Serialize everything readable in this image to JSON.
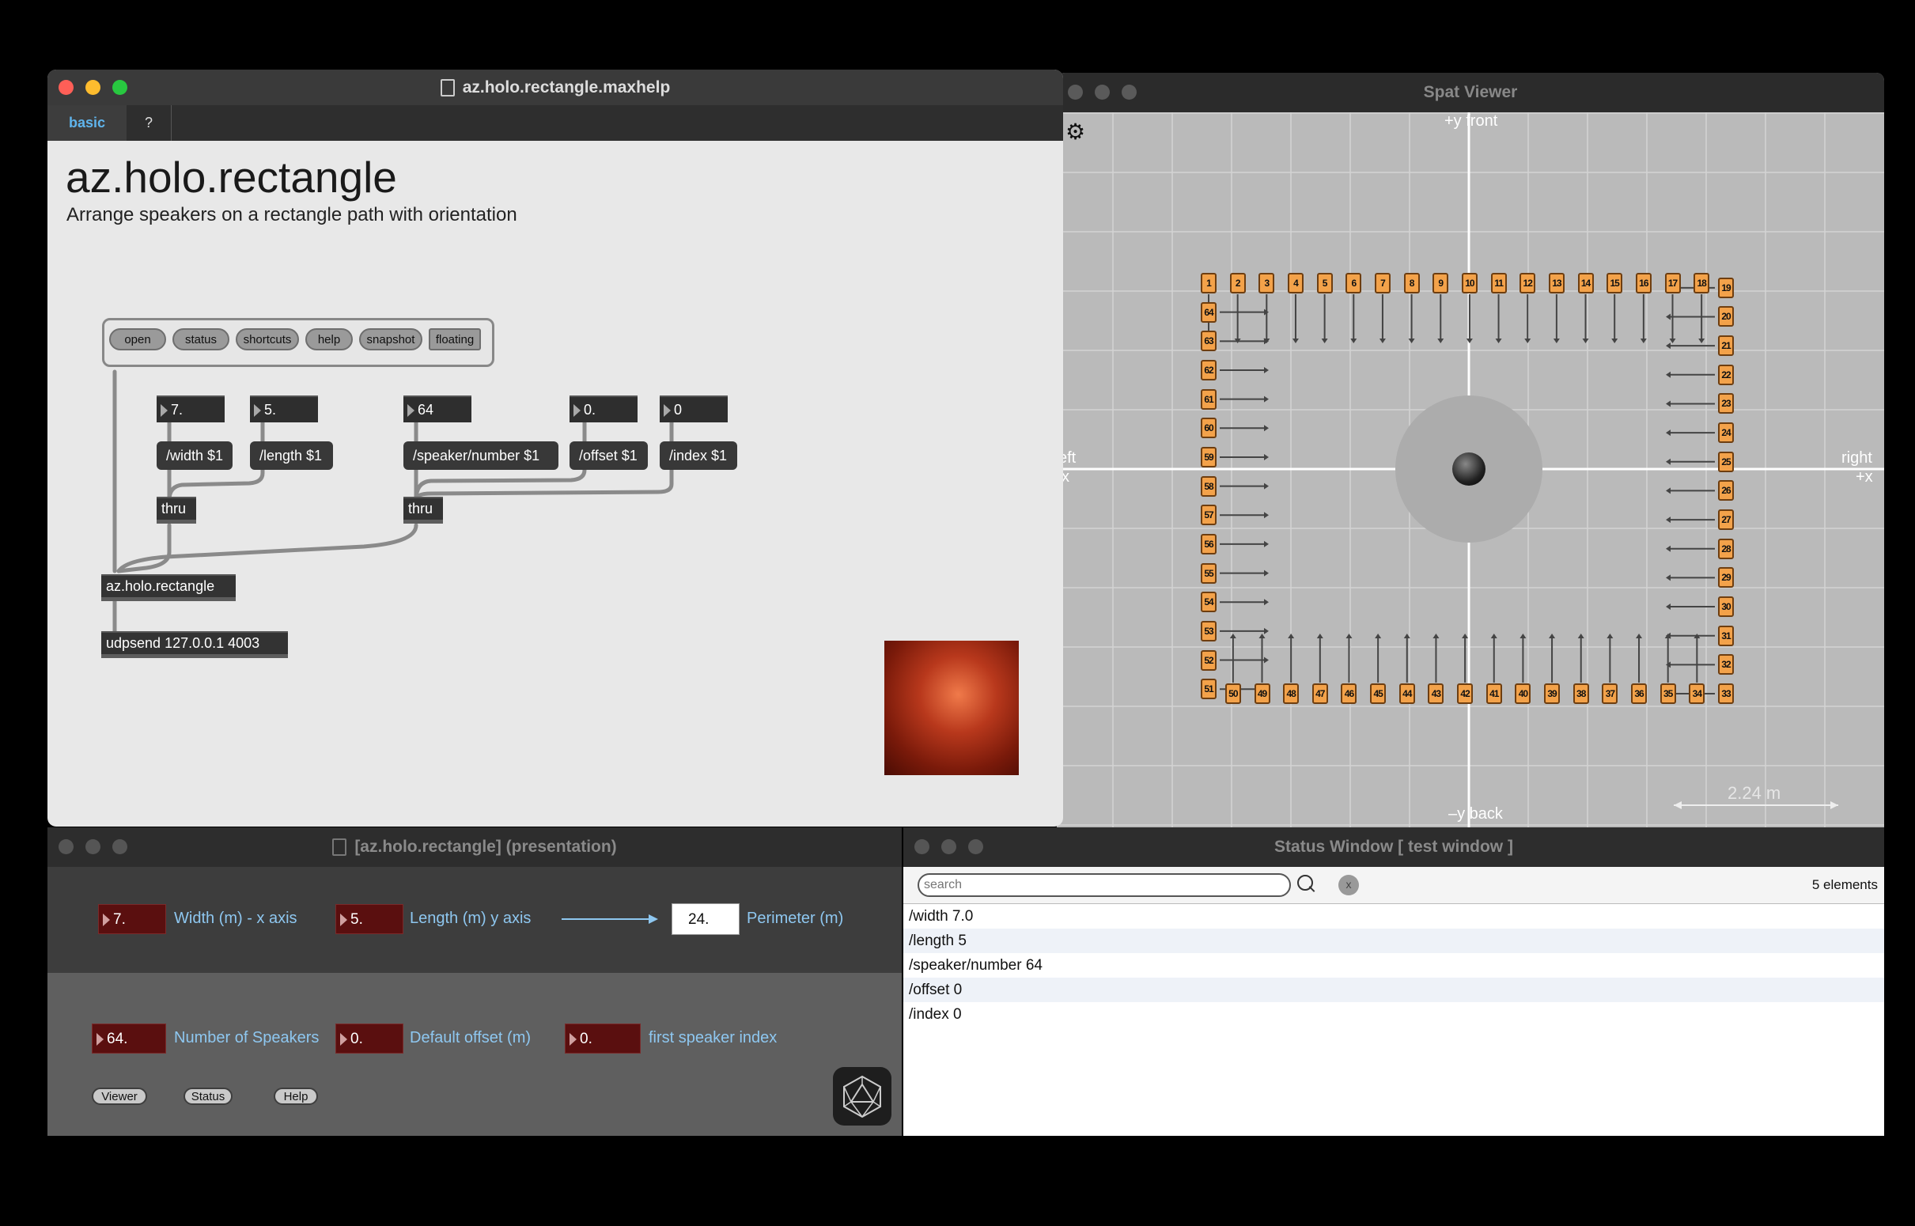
{
  "help_window": {
    "title": "az.holo.rectangle.maxhelp",
    "tabs": [
      "basic",
      "?"
    ],
    "heading": "az.holo.rectangle",
    "subtitle": "Arrange speakers on a rectangle path with orientation",
    "buttons": [
      "open",
      "status",
      "shortcuts",
      "help",
      "snapshot",
      "floating"
    ],
    "numbers": [
      "7.",
      "5.",
      "64",
      "0.",
      "0"
    ],
    "messages": [
      "/width $1",
      "/length $1",
      "/speaker/number $1",
      "/offset $1",
      "/index $1"
    ],
    "thru": "thru",
    "main_object": "az.holo.rectangle",
    "udp_object": "udpsend 127.0.0.1 4003"
  },
  "spat_viewer": {
    "title": "Spat Viewer",
    "front_label": "+y front",
    "back_label": "–y back",
    "left_label": "eft",
    "left_axis": "x",
    "right_label": "right",
    "right_axis": "+x",
    "scale": "2.24 m",
    "speakers": [
      "1",
      "2",
      "3",
      "4",
      "5",
      "6",
      "7",
      "8",
      "9",
      "10",
      "11",
      "12",
      "13",
      "14",
      "15",
      "16",
      "17",
      "18",
      "19",
      "20",
      "21",
      "22",
      "23",
      "24",
      "25",
      "26",
      "27",
      "28",
      "29",
      "30",
      "31",
      "32",
      "33",
      "34",
      "35",
      "36",
      "37",
      "38",
      "39",
      "40",
      "41",
      "42",
      "43",
      "44",
      "45",
      "46",
      "47",
      "48",
      "49",
      "50",
      "51",
      "52",
      "53",
      "54",
      "55",
      "56",
      "57",
      "58",
      "59",
      "60",
      "61",
      "62",
      "63",
      "64"
    ]
  },
  "presentation": {
    "title": "[az.holo.rectangle] (presentation)",
    "width_value": "7.",
    "width_label": "Width (m) - x axis",
    "length_value": "5.",
    "length_label": "Length (m) y axis",
    "perimeter_value": "24.",
    "perimeter_label": "Perimeter (m)",
    "speakers_value": "64.",
    "speakers_label": "Number of Speakers",
    "offset_value": "0.",
    "offset_label": "Default offset (m)",
    "index_value": "0.",
    "index_label": "first speaker index",
    "buttons": [
      "Viewer",
      "Status",
      "Help"
    ]
  },
  "status_window": {
    "title": "Status Window [  test window ]",
    "search_placeholder": "search",
    "clear_label": "x",
    "count": "5 elements",
    "items": [
      "/width 7.0",
      "/length 5",
      "/speaker/number 64",
      "/offset 0",
      "/index 0"
    ]
  },
  "colors": {
    "accent_blue": "#8ec7f0",
    "speaker_orange": "#f3a24a",
    "number_red": "#5a0f0f"
  }
}
